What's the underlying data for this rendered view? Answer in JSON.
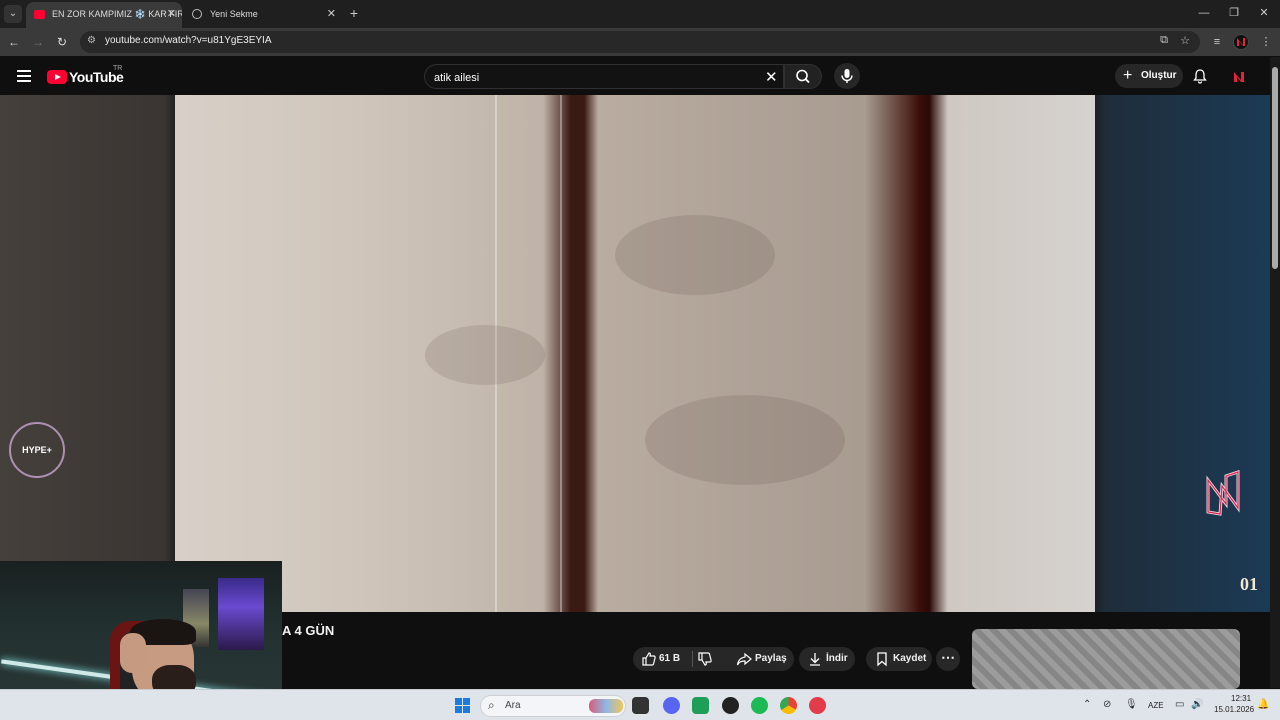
{
  "browser": {
    "tabs": [
      {
        "title": "EN ZOR KAMPIMIZ ❄️ KAR FIR",
        "active": true
      },
      {
        "title": "Yeni Sekme",
        "active": false
      }
    ],
    "url": "youtube.com/watch?v=u81YgE3EYIA"
  },
  "youtube": {
    "logo_text": "YouTube",
    "country_code": "TR",
    "search_value": "atik ailesi",
    "create_label": "Oluştur"
  },
  "overlay": {
    "hype_label": "HYPE+",
    "corner_badge": "01"
  },
  "video": {
    "title_fragment": "A 4 GÜN",
    "like_count": "61 B",
    "share_label": "Paylaş",
    "download_label": "İndir",
    "save_label": "Kaydet"
  },
  "taskbar": {
    "search_placeholder": "Ara",
    "language": "AZE",
    "time": "12:31",
    "date": "15.01.2026"
  },
  "colors": {
    "youtube_red": "#ff0033",
    "chrome_dark": "#1f1f1f",
    "page_bg": "#0f0f0f"
  }
}
